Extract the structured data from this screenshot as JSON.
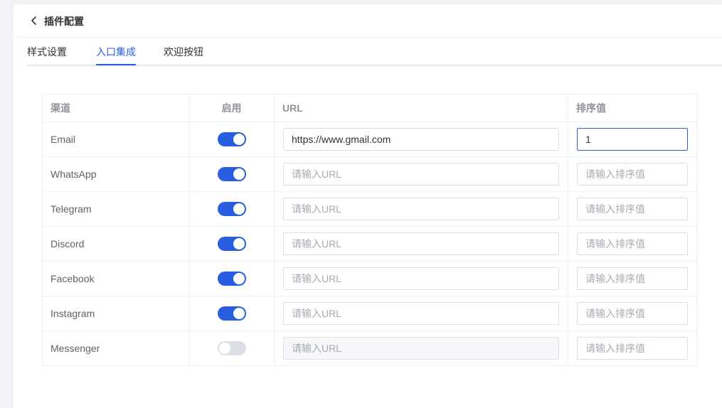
{
  "header": {
    "title": "插件配置"
  },
  "tabs": [
    {
      "label": "样式设置",
      "active": false
    },
    {
      "label": "入口集成",
      "active": true
    },
    {
      "label": "欢迎按钮",
      "active": false
    }
  ],
  "colors": {
    "accent": "#2a5ee0",
    "switch_off": "#dcdfe6"
  },
  "table": {
    "columns": [
      "渠道",
      "启用",
      "URL",
      "排序值"
    ],
    "rows": [
      {
        "channel": "Email",
        "enabled": true,
        "url": "https://www.gmail.com",
        "url_placeholder": "请输入URL",
        "order": "1",
        "order_placeholder": "请输入排序值"
      },
      {
        "channel": "WhatsApp",
        "enabled": true,
        "url": "",
        "url_placeholder": "请输入URL",
        "order": "",
        "order_placeholder": "请输入排序值"
      },
      {
        "channel": "Telegram",
        "enabled": true,
        "url": "",
        "url_placeholder": "请输入URL",
        "order": "",
        "order_placeholder": "请输入排序值"
      },
      {
        "channel": "Discord",
        "enabled": true,
        "url": "",
        "url_placeholder": "请输入URL",
        "order": "",
        "order_placeholder": "请输入排序值"
      },
      {
        "channel": "Facebook",
        "enabled": true,
        "url": "",
        "url_placeholder": "请输入URL",
        "order": "",
        "order_placeholder": "请输入排序值"
      },
      {
        "channel": "Instagram",
        "enabled": true,
        "url": "",
        "url_placeholder": "请输入URL",
        "order": "",
        "order_placeholder": "请输入排序值"
      },
      {
        "channel": "Messenger",
        "enabled": false,
        "url": "",
        "url_placeholder": "请输入URL",
        "order": "",
        "order_placeholder": "请输入排序值"
      }
    ]
  }
}
